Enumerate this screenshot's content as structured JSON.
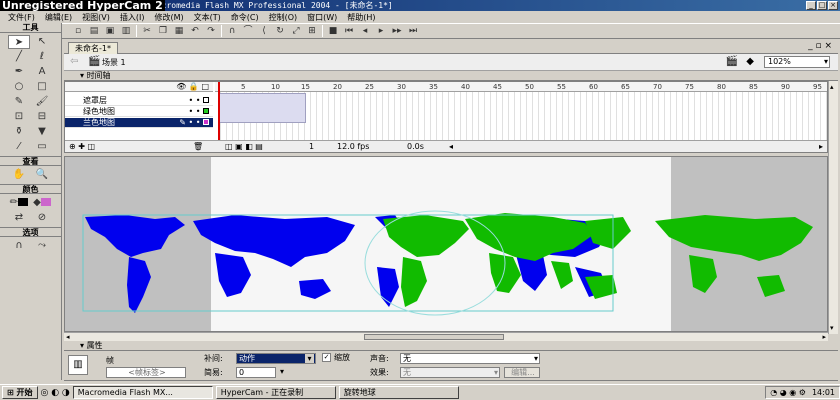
{
  "watermark": "Unregistered HyperCam 2",
  "window_title": "Macromedia Flash MX Professional 2004 - [未命名-1*]",
  "menu": [
    "文件(F)",
    "编辑(E)",
    "视图(V)",
    "插入(I)",
    "修改(M)",
    "文本(T)",
    "命令(C)",
    "控制(O)",
    "窗口(W)",
    "帮助(H)"
  ],
  "tools": {
    "title": "工具",
    "view_title": "查看",
    "colors_title": "颜色",
    "options_title": "选项"
  },
  "doc_tab": "未命名-1*",
  "scene": "场景 1",
  "zoom": "102%",
  "timeline": {
    "title": "时间轴",
    "layers": [
      "遮罩层",
      "绿色地图",
      "兰色地图"
    ],
    "ticks": [
      "5",
      "10",
      "15",
      "20",
      "25",
      "30",
      "35",
      "40",
      "45",
      "50",
      "55",
      "60",
      "65",
      "70",
      "75",
      "80",
      "85",
      "90",
      "95"
    ],
    "frame": "1",
    "fps": "12.0 fps",
    "time": "0.0s"
  },
  "properties": {
    "title": "属性",
    "frame_label": "帧",
    "frame_name_placeholder": "<帧标签>",
    "tween_label": "补间:",
    "tween_value": "动作",
    "scale_label": "缩放",
    "ease_label": "简易:",
    "ease_value": "0",
    "sound_label": "声音:",
    "sound_value": "无",
    "effect_label": "效果:",
    "effect_value": "无",
    "edit_button": "编辑..."
  },
  "taskbar": {
    "start": "开始",
    "items": [
      "Macromedia Flash MX...",
      "HyperCam - 正在录制",
      "旋转地球"
    ],
    "clock": "14:01"
  },
  "colors": {
    "blue_map": "#0000ee",
    "green_map": "#11bb00",
    "stage_bg": "#f6f6f6"
  }
}
